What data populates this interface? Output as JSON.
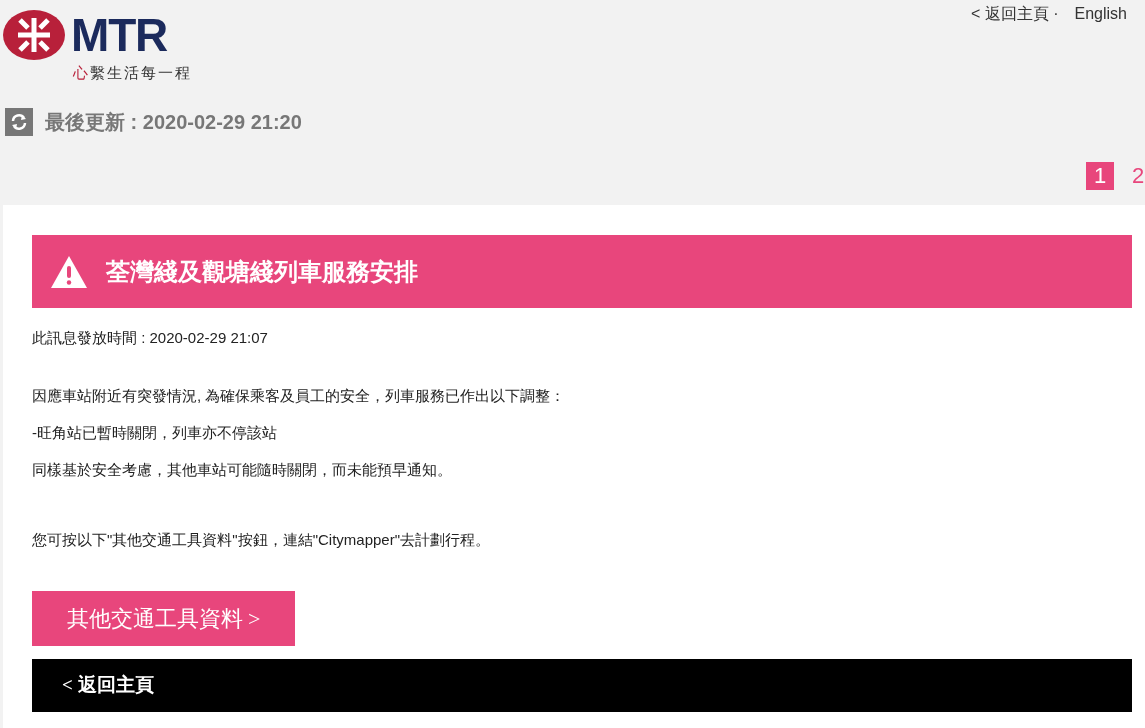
{
  "header": {
    "logo_text": "MTR",
    "tagline_mark": "心",
    "tagline": "繫生活每一程",
    "last_updated": "最後更新 : 2020-02-29 21:20",
    "links": [
      "< 返回主頁 ·",
      "English"
    ]
  },
  "pagination": [
    {
      "label": "1",
      "selected": true
    },
    {
      "label": "2",
      "selected": false
    }
  ],
  "alert": {
    "title": "荃灣綫及觀塘綫列車服務安排",
    "issued": "此訊息發放時間 : 2020-02-29 21:07",
    "paragraphs": [
      "因應車站附近有突發情況, 為確保乘客及員工的安全，列車服務已作出以下調整：",
      "-旺角站已暫時關閉，列車亦不停該站",
      "同樣基於安全考慮，其他車站可能隨時關閉，而未能預早通知。"
    ],
    "note": "您可按以下\"其他交通工具資料\"按鈕，連結\"Citymapper\"去計劃行程。"
  },
  "buttons": {
    "other_transport": "其他交通工具資料 >",
    "back_home": "< 返回主頁"
  }
}
